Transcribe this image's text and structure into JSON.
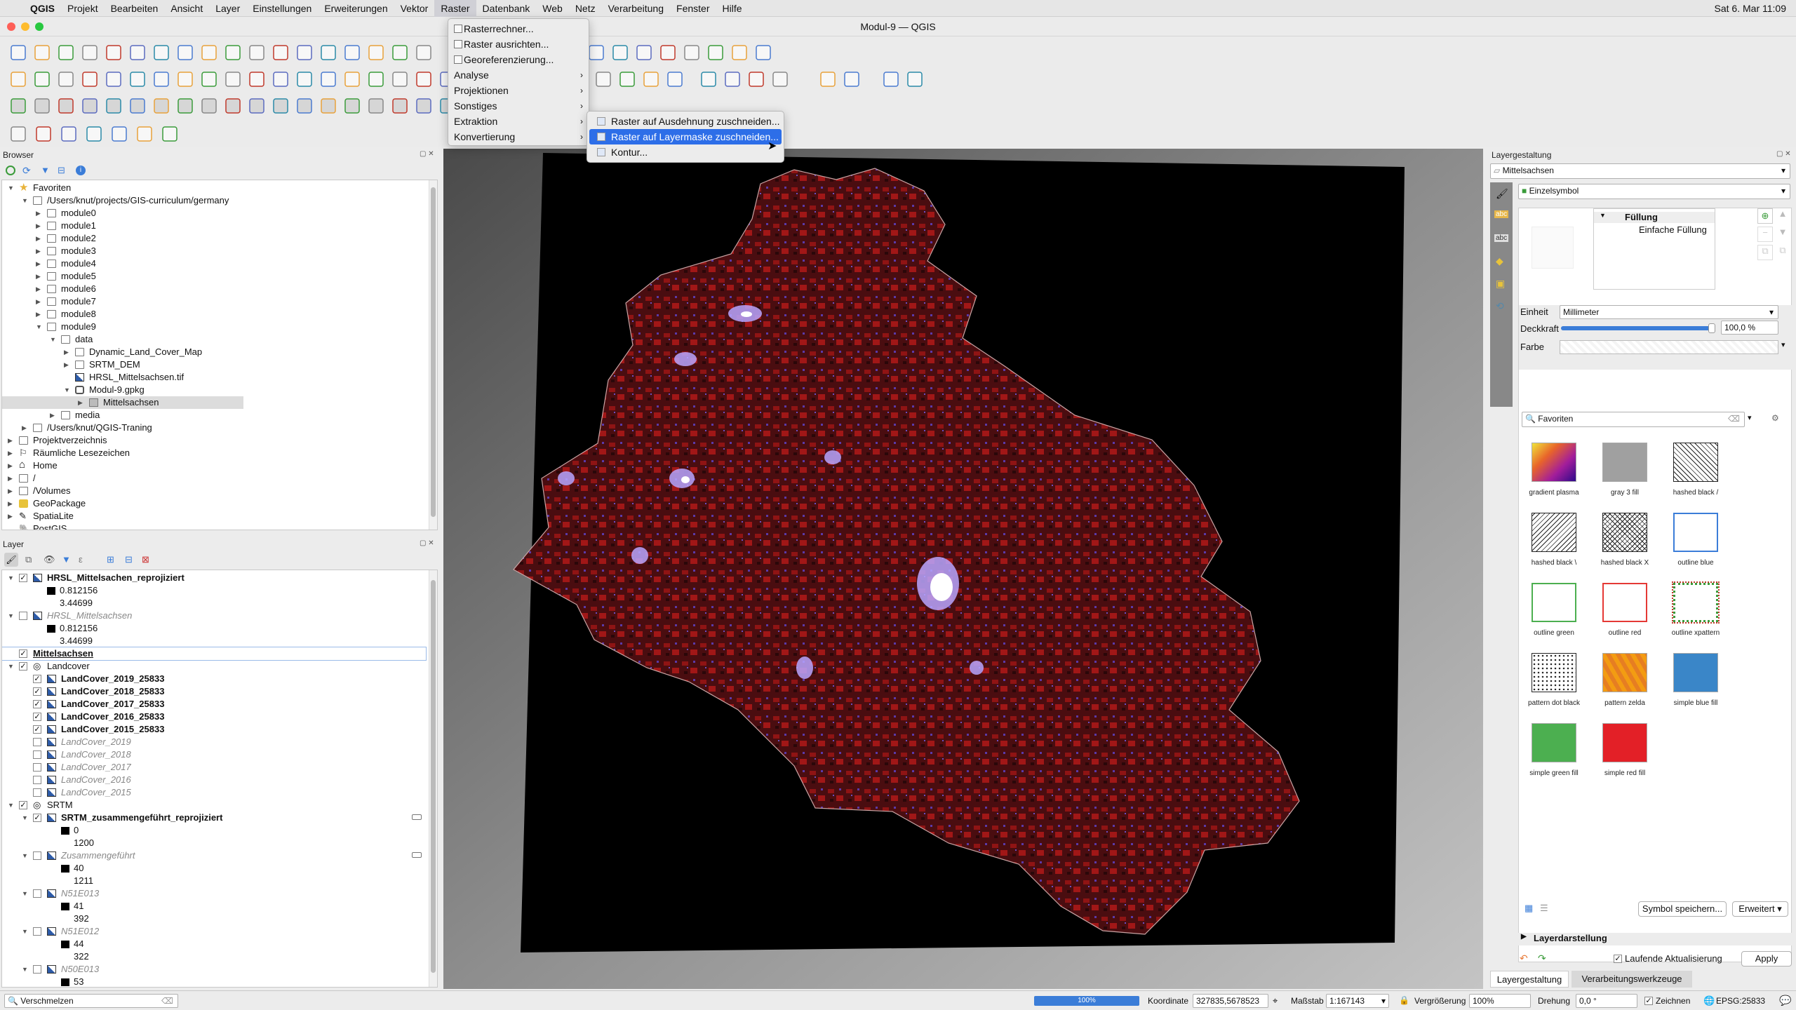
{
  "menubar": {
    "app": "QGIS",
    "items": [
      "Projekt",
      "Bearbeiten",
      "Ansicht",
      "Layer",
      "Einstellungen",
      "Erweiterungen",
      "Vektor",
      "Raster",
      "Datenbank",
      "Web",
      "Netz",
      "Verarbeitung",
      "Fenster",
      "Hilfe"
    ],
    "active": "Raster",
    "clock": "Sat 6. Mar 11:09"
  },
  "window": {
    "title": "Modul-9 — QGIS"
  },
  "raster_menu": {
    "items": [
      {
        "label": "Rasterrechner...",
        "sub": false
      },
      {
        "label": "Raster ausrichten...",
        "sub": false
      },
      {
        "label": "Georeferenzierung...",
        "sub": false
      },
      {
        "label": "Analyse",
        "sub": true
      },
      {
        "label": "Projektionen",
        "sub": true
      },
      {
        "label": "Sonstiges",
        "sub": true
      },
      {
        "label": "Extraktion",
        "sub": true
      },
      {
        "label": "Konvertierung",
        "sub": true
      }
    ]
  },
  "extraction_submenu": {
    "items": [
      "Raster auf Ausdehnung zuschneiden...",
      "Raster auf Layermaske zuschneiden...",
      "Kontur..."
    ],
    "highlighted": 1
  },
  "browser": {
    "title": "Browser",
    "favorites": "Favoriten",
    "path": "/Users/knut/projects/GIS-curriculum/germany",
    "modules": [
      "module0",
      "module1",
      "module2",
      "module3",
      "module4",
      "module5",
      "module6",
      "module7",
      "module8",
      "module9"
    ],
    "data": "data",
    "dlcm": "Dynamic_Land_Cover_Map",
    "srtm": "SRTM_DEM",
    "hrsl": "HRSL_Mittelsachsen.tif",
    "gpkg": "Modul-9.gpkg",
    "mittelsachsen": "Mittelsachsen",
    "media": "media",
    "qgis_traning": "/Users/knut/QGIS-Traning",
    "others": [
      "Projektverzeichnis",
      "Räumliche Lesezeichen",
      "Home",
      "/",
      "/Volumes",
      "GeoPackage",
      "SpatiaLite",
      "PostGIS"
    ]
  },
  "layers": {
    "title": "Layer",
    "rows": [
      {
        "label": "HRSL_Mittelsachen_reprojiziert",
        "style": "bold",
        "check": true,
        "type": "raster",
        "indent": 0,
        "arrow": true
      },
      {
        "label": "0.812156",
        "style": "swatch",
        "indent": 1
      },
      {
        "label": "3.44699",
        "style": "plain",
        "indent": 1
      },
      {
        "label": "HRSL_Mittelsachsen",
        "style": "ital",
        "check": false,
        "type": "raster",
        "indent": 0,
        "arrow": true
      },
      {
        "label": "0.812156",
        "style": "swatch",
        "indent": 1
      },
      {
        "label": "3.44699",
        "style": "plain",
        "indent": 1
      },
      {
        "label": "Mittelsachsen",
        "style": "sel",
        "check": true,
        "type": "none",
        "indent": 0
      },
      {
        "label": "Landcover",
        "style": "plain",
        "check": true,
        "type": "group",
        "indent": 0,
        "arrow": true
      },
      {
        "label": "LandCover_2019_25833",
        "style": "bold",
        "check": true,
        "type": "raster",
        "indent": 1
      },
      {
        "label": "LandCover_2018_25833",
        "style": "bold",
        "check": true,
        "type": "raster",
        "indent": 1
      },
      {
        "label": "LandCover_2017_25833",
        "style": "bold",
        "check": true,
        "type": "raster",
        "indent": 1
      },
      {
        "label": "LandCover_2016_25833",
        "style": "bold",
        "check": true,
        "type": "raster",
        "indent": 1
      },
      {
        "label": "LandCover_2015_25833",
        "style": "bold",
        "check": true,
        "type": "raster",
        "indent": 1
      },
      {
        "label": "LandCover_2019",
        "style": "ital",
        "check": false,
        "type": "raster",
        "indent": 1
      },
      {
        "label": "LandCover_2018",
        "style": "ital",
        "check": false,
        "type": "raster",
        "indent": 1
      },
      {
        "label": "LandCover_2017",
        "style": "ital",
        "check": false,
        "type": "raster",
        "indent": 1
      },
      {
        "label": "LandCover_2016",
        "style": "ital",
        "check": false,
        "type": "raster",
        "indent": 1
      },
      {
        "label": "LandCover_2015",
        "style": "ital",
        "check": false,
        "type": "raster",
        "indent": 1
      },
      {
        "label": "SRTM",
        "style": "plain",
        "check": true,
        "type": "group",
        "indent": 0,
        "arrow": true
      },
      {
        "label": "SRTM_zusammengeführt_reprojiziert",
        "style": "bold",
        "check": true,
        "type": "raster",
        "indent": 1,
        "arrow": true
      },
      {
        "label": "0",
        "style": "swatch",
        "indent": 2
      },
      {
        "label": "1200",
        "style": "plain",
        "indent": 2
      },
      {
        "label": "Zusammengeführt",
        "style": "ital",
        "check": false,
        "type": "raster",
        "indent": 1,
        "arrow": true
      },
      {
        "label": "40",
        "style": "swatch",
        "indent": 2
      },
      {
        "label": "1211",
        "style": "plain",
        "indent": 2
      },
      {
        "label": "N51E013",
        "style": "ital",
        "check": false,
        "type": "raster",
        "indent": 1,
        "arrow": true
      },
      {
        "label": "41",
        "style": "swatch",
        "indent": 2
      },
      {
        "label": "392",
        "style": "plain",
        "indent": 2
      },
      {
        "label": "N51E012",
        "style": "ital",
        "check": false,
        "type": "raster",
        "indent": 1,
        "arrow": true
      },
      {
        "label": "44",
        "style": "swatch",
        "indent": 2
      },
      {
        "label": "322",
        "style": "plain",
        "indent": 2
      },
      {
        "label": "N50E013",
        "style": "ital",
        "check": false,
        "type": "raster",
        "indent": 1,
        "arrow": true
      },
      {
        "label": "53",
        "style": "swatch",
        "indent": 2
      }
    ]
  },
  "search": {
    "placeholder": "Verschmelzen",
    "value": "Verschmelzen"
  },
  "styling": {
    "title": "Layergestaltung",
    "layer": "Mittelsachsen",
    "renderer": "Einzelsymbol",
    "fill": "Füllung",
    "simple_fill": "Einfache Füllung",
    "unit_label": "Einheit",
    "unit": "Millimeter",
    "opacity_label": "Deckkraft",
    "opacity": "100,0 %",
    "opacity_value": 1.0,
    "color_label": "Farbe",
    "fav_search": "Favoriten",
    "symbols": [
      {
        "label": "gradient  plasma",
        "kind": "gradient"
      },
      {
        "label": "gray 3 fill",
        "kind": "gray"
      },
      {
        "label": "hashed black /",
        "kind": "hash1"
      },
      {
        "label": "hashed black \\",
        "kind": "hash2"
      },
      {
        "label": "hashed black X",
        "kind": "hashx"
      },
      {
        "label": "outline blue",
        "kind": "oblue"
      },
      {
        "label": "outline green",
        "kind": "ogreen"
      },
      {
        "label": "outline red",
        "kind": "ored"
      },
      {
        "label": "outline xpattern",
        "kind": "oxpat"
      },
      {
        "label": "pattern dot black",
        "kind": "dots"
      },
      {
        "label": "pattern zelda",
        "kind": "zelda"
      },
      {
        "label": "simple blue fill",
        "kind": "blue"
      },
      {
        "label": "simple green fill",
        "kind": "green"
      },
      {
        "label": "simple red fill",
        "kind": "red"
      }
    ],
    "save_symbol": "Symbol speichern...",
    "advanced": "Erweitert",
    "layer_rendering": "Layerdarstellung",
    "live_update": "Laufende Aktualisierung",
    "apply": "Apply"
  },
  "bottom_tabs": [
    "Layergestaltung",
    "Verarbeitungswerkzeuge"
  ],
  "status": {
    "progress": "100%",
    "progress_value": 1.0,
    "coord_label": "Koordinate",
    "coord": "327835,5678523",
    "scale_label": "Maßstab",
    "scale": "1:167143",
    "mag_label": "Vergrößerung",
    "mag": "100%",
    "rot_label": "Drehung",
    "rot": "0,0 °",
    "render": "Zeichnen",
    "crs": "EPSG:25833"
  }
}
